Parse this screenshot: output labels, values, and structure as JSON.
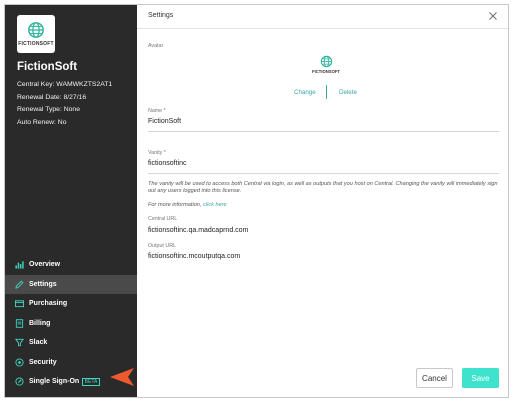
{
  "sidebar": {
    "logo_text": "FICTIONSOFT",
    "company_name": "FictionSoft",
    "central_key": "Central Key: WAMWKZTS2AT1",
    "renewal_date": "Renewal Date: 8/27/16",
    "renewal_type": "Renewal Type: None",
    "auto_renew": "Auto Renew: No",
    "nav": [
      {
        "label": "Overview",
        "icon": "chart-icon"
      },
      {
        "label": "Settings",
        "icon": "pencil-icon",
        "active": true
      },
      {
        "label": "Purchasing",
        "icon": "card-icon"
      },
      {
        "label": "Billing",
        "icon": "receipt-icon"
      },
      {
        "label": "Slack",
        "icon": "funnel-icon"
      },
      {
        "label": "Security",
        "icon": "shield-icon"
      },
      {
        "label": "Single Sign-On",
        "icon": "key-icon",
        "badge": "BETA"
      }
    ]
  },
  "modal": {
    "title": "Settings",
    "avatar_label": "Avatar",
    "avatar_text": "FICTIONSOFT",
    "change_link": "Change",
    "delete_link": "Delete",
    "name_label": "Name *",
    "name_value": "FictionSoft",
    "vanity_label": "Vanity *",
    "vanity_value": "fictionsoftinc",
    "notice": "The vanity will be used to access both Central via login, as well as outputs that you host on Central. Changing the vanity will immediately sign out any users logged into this license.",
    "more_info": "For more information,",
    "click_here": "click here",
    "central_url_label": "Central URL",
    "central_url_value": "fictionsoftinc.qa.madcaprnd.com",
    "output_url_label": "Output URL",
    "output_url_value": "fictionsoftinc.mcoutputqa.com",
    "cancel_label": "Cancel",
    "save_label": "Save"
  },
  "colors": {
    "sidebar_bg": "#2a2a2a",
    "accent": "#3fe2cd",
    "arrow": "#ee5a2e"
  }
}
